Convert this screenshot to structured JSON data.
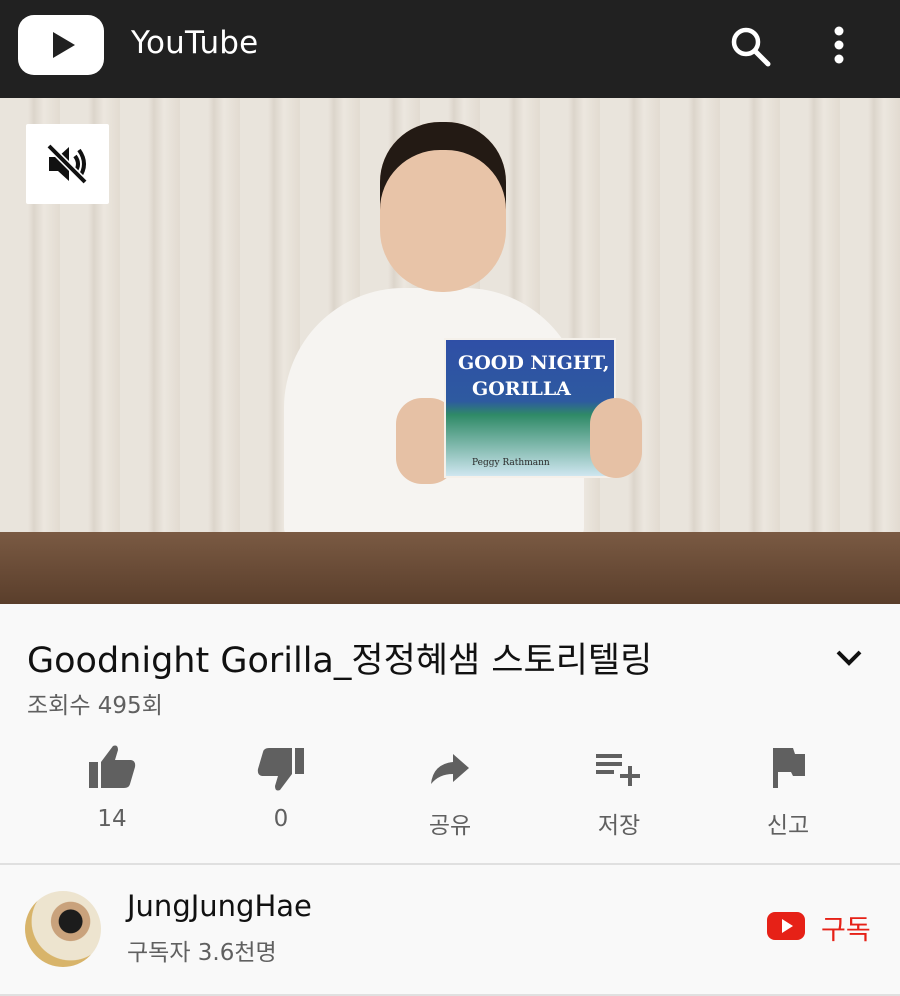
{
  "header": {
    "app_title": "YouTube",
    "logo_icon": "youtube-logo-icon",
    "search_icon": "search-icon",
    "more_icon": "more-vert-icon",
    "background": "#212121"
  },
  "player": {
    "mute_icon": "volume-off-icon",
    "book_title_line1": "GOOD NIGHT,",
    "book_title_line2": "GORILLA",
    "book_author": "Peggy Rathmann"
  },
  "video": {
    "title": "Goodnight Gorilla_정정혜샘 스토리텔링",
    "views": "조회수 495회",
    "expand_icon": "chevron-down-icon"
  },
  "actions": [
    {
      "icon": "thumbs-up-icon",
      "label": "14"
    },
    {
      "icon": "thumbs-down-icon",
      "label": "0"
    },
    {
      "icon": "share-icon",
      "label": "공유"
    },
    {
      "icon": "playlist-add-icon",
      "label": "저장"
    },
    {
      "icon": "flag-icon",
      "label": "신고"
    }
  ],
  "channel": {
    "name": "JungJungHae",
    "subscribers": "구독자 3.6천명",
    "subscribe_label": "구독",
    "accent": "#e62117"
  }
}
